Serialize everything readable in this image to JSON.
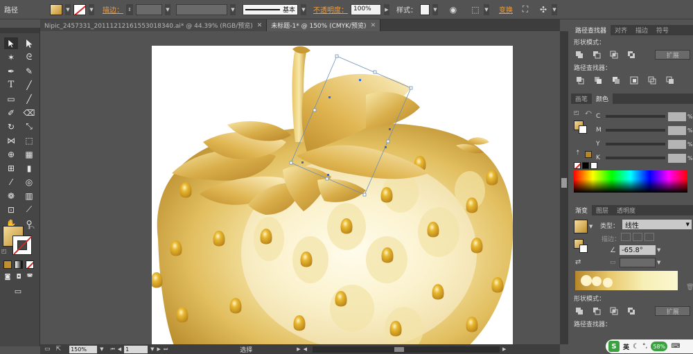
{
  "control_bar": {
    "object_label": "路径",
    "stroke_label": "描边：",
    "stroke_profile": "基本",
    "opacity_label": "不透明度：",
    "opacity_value": "100%",
    "style_label": "样式：",
    "transform_label": "变换"
  },
  "tabs": [
    {
      "label": "Nipic_2457331_20111212161553018340.ai* @ 44.39% (RGB/预览)",
      "active": false
    },
    {
      "label": "未标题-1* @ 150% (CMYK/预览)",
      "active": true
    }
  ],
  "status_bar": {
    "zoom": "150%",
    "page": "1",
    "tool_status": "选择"
  },
  "pathfinder_panel": {
    "tabs": [
      "路径查找器",
      "对齐",
      "描边",
      "符号"
    ],
    "shape_modes_label": "形状模式：",
    "pathfinders_label": "路径查找器：",
    "expand_label": "扩展"
  },
  "color_panel": {
    "tabs": [
      "画笔",
      "颜色"
    ],
    "channels": [
      "C",
      "M",
      "Y",
      "K"
    ],
    "percent": "%"
  },
  "gradient_panel": {
    "tabs": [
      "渐变",
      "图层",
      "透明度"
    ],
    "type_label": "类型：",
    "type_value": "线性",
    "stroke_label": "描边：",
    "angle_value": "-65.8°",
    "shape_modes_label": "形状模式：",
    "pathfinders_label": "路径查找器：",
    "expand_label": "扩展"
  },
  "system_tray": {
    "ime_label": "英",
    "battery": "58%"
  },
  "colors": {
    "gold_light": "#f5dc9c",
    "gold_dark": "#c0902e",
    "seed": "#d4a020",
    "ui_bg": "#535353",
    "accent_link": "#f0a040"
  }
}
